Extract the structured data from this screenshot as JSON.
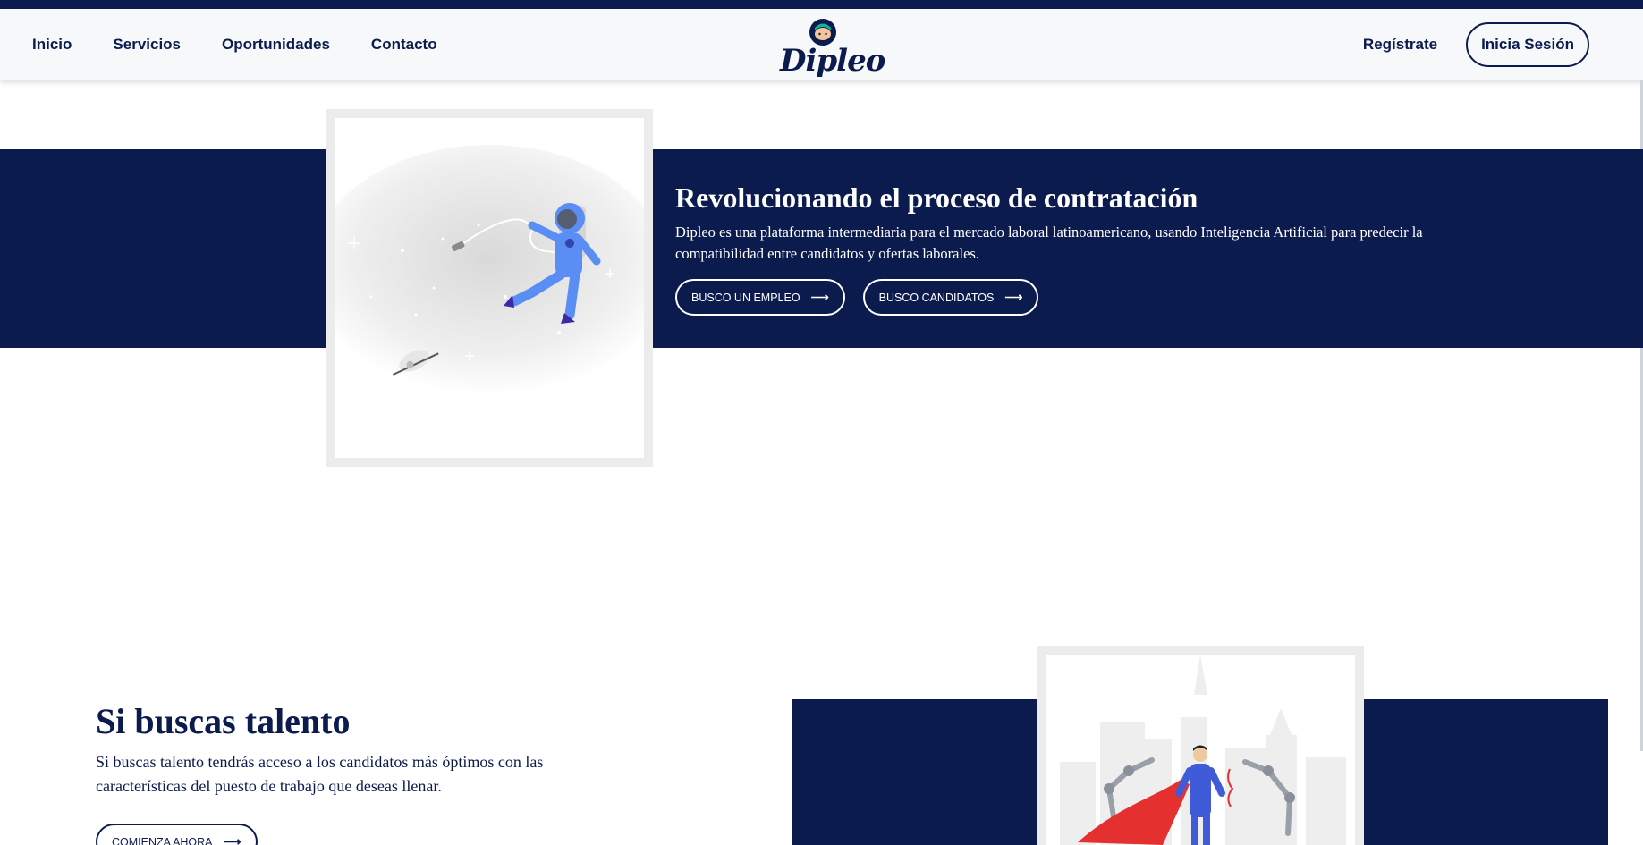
{
  "nav": {
    "links": [
      "Inicio",
      "Servicios",
      "Oportunidades",
      "Contacto"
    ],
    "logo_text": "Dipleo",
    "register": "Regístrate",
    "login": "Inicia Sesión"
  },
  "hero": {
    "title": "Revolucionando el proceso de contratación",
    "description": "Dipleo es una plataforma intermediaria para el mercado laboral latinoamericano, usando Inteligencia Artificial para predecir la compatibilidad entre candidatos y ofertas laborales.",
    "buttons": [
      "BUSCO UN EMPLEO",
      "BUSCO CANDIDATOS"
    ],
    "arrow": "⟶"
  },
  "talent": {
    "title_prefix": "Si buscas",
    "title_highlight": "talento",
    "description": "Si buscas talento tendrás acceso a los candidatos más óptimos con las características del puesto de trabajo que deseas llenar.",
    "button": "COMIENZA AHORA"
  },
  "colors": {
    "navy": "#0b1b4d",
    "accent": "#14b3a0",
    "frame": "#ececec"
  },
  "icons": [
    "astronaut-illustration",
    "space-shuttle-illustration",
    "superhero-robot-arms-illustration",
    "arrow-right-icon"
  ]
}
